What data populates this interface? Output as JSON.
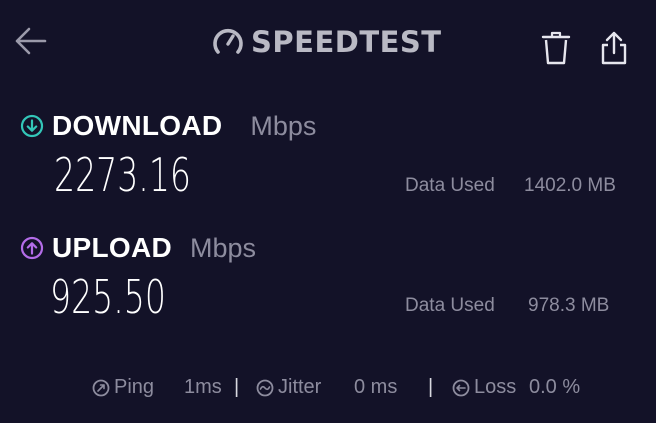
{
  "header": {
    "logo_text": "SPEEDTEST",
    "back_icon": "arrow-left-icon",
    "trash_icon": "trash-icon",
    "share_icon": "share-icon"
  },
  "download": {
    "label": "DOWNLOAD",
    "unit": "Mbps",
    "value": "2273.16",
    "data_used_label": "Data Used",
    "data_used_value": "1402.0 MB",
    "icon": "download-arrow-icon",
    "icon_color": "#33c6b8"
  },
  "upload": {
    "label": "UPLOAD",
    "unit": "Mbps",
    "value": "925.50",
    "data_used_label": "Data Used",
    "data_used_value": "978.3 MB",
    "icon": "upload-arrow-icon",
    "icon_color": "#b36ce8"
  },
  "stats": {
    "ping_label": "Ping",
    "ping_value": "1ms",
    "jitter_label": "Jitter",
    "jitter_value": "0 ms",
    "loss_label": "Loss",
    "loss_value": "0.0 %",
    "separator": "|"
  },
  "colors": {
    "background": "#131228",
    "muted_text": "#8d8c9e",
    "logo": "#b9b9c4"
  }
}
